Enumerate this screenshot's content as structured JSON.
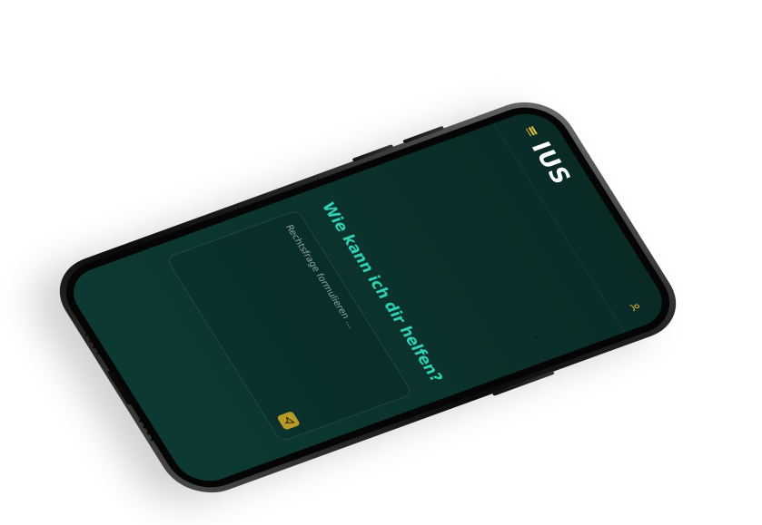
{
  "app": {
    "logo": "IUS"
  },
  "header": {
    "menu_icon": "menu-icon",
    "user_icon": "user-icon"
  },
  "main": {
    "headline": "Wie kann ich dir helfen?",
    "input_placeholder": "Rechtsfrage formulieren ...",
    "send_icon": "send-icon"
  },
  "colors": {
    "background": "#0b332d",
    "accent": "#2fd0b4",
    "brand_gold": "#e9c23c",
    "send_button": "#b79a28"
  }
}
